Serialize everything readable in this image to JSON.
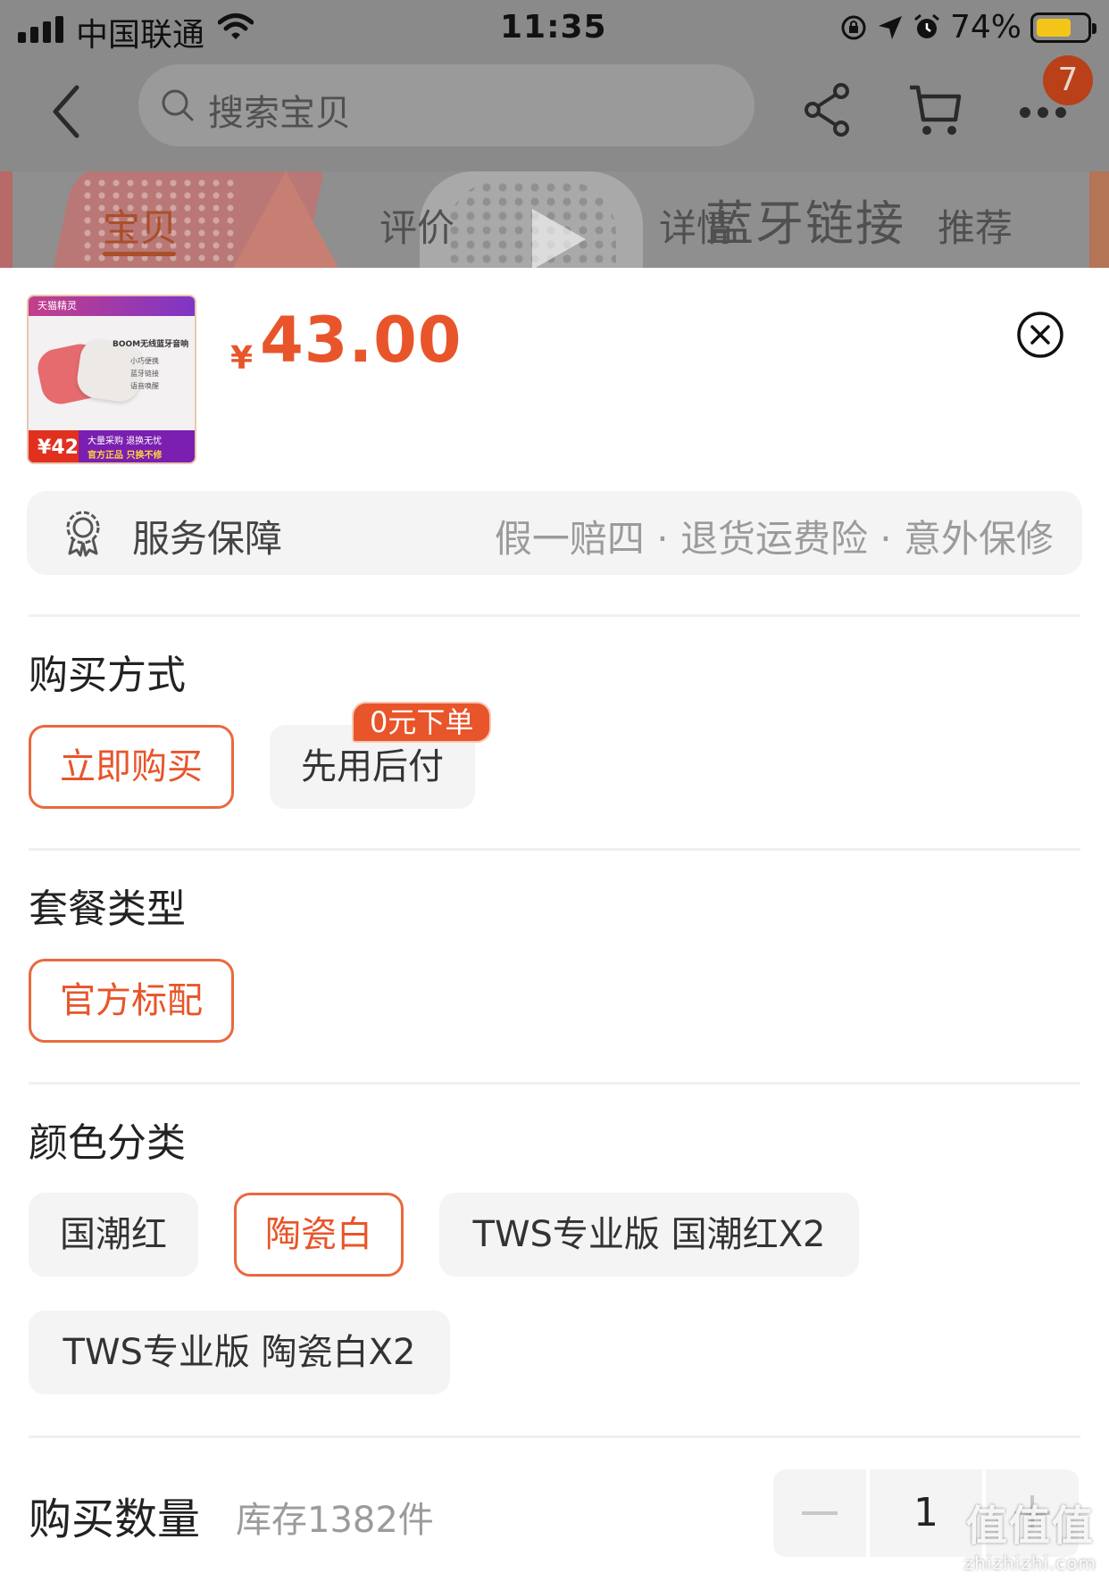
{
  "status_bar": {
    "carrier": "中国联通",
    "time": "11:35",
    "battery": "74%",
    "battery_level": 0.74
  },
  "nav": {
    "search_placeholder": "搜索宝贝",
    "cart_badge": "7"
  },
  "tabs": [
    {
      "label": "宝贝",
      "active": true
    },
    {
      "label": "评价",
      "active": false
    },
    {
      "label": "详情",
      "active": false
    },
    {
      "label": "推荐",
      "active": false
    }
  ],
  "product_overlay_headline": "蓝牙链接",
  "thumbnail": {
    "brand": "天猫精灵",
    "title": "BOOM无线蓝牙音响",
    "lines": [
      "小巧便携",
      "蓝牙链接",
      "语音唤醒"
    ],
    "price": "42",
    "tagline": "大量采购 退换无忧",
    "tagline2": "官方正品 只换不修"
  },
  "price": {
    "currency": "¥",
    "amount": "43.00"
  },
  "service": {
    "label": "服务保障",
    "values": "假一赔四 · 退货运费险 · 意外保修"
  },
  "purchase_method": {
    "title": "购买方式",
    "options": [
      {
        "label": "立即购买",
        "selected": true
      },
      {
        "label": "先用后付",
        "selected": false
      }
    ],
    "badge": "0元下单"
  },
  "package_type": {
    "title": "套餐类型",
    "options": [
      {
        "label": "官方标配",
        "selected": true
      }
    ]
  },
  "color_category": {
    "title": "颜色分类",
    "options": [
      {
        "label": "国潮红",
        "selected": false
      },
      {
        "label": "陶瓷白",
        "selected": true
      },
      {
        "label": "TWS专业版 国潮红X2",
        "selected": false
      },
      {
        "label": "TWS专业版 陶瓷白X2",
        "selected": false
      }
    ]
  },
  "quantity": {
    "label": "购买数量",
    "stock": "库存1382件",
    "value": "1"
  },
  "watermark": {
    "main": "值值值",
    "sub": "zhizhizhi.com"
  },
  "colors": {
    "accent": "#e8552a",
    "accent_border": "#e9693e",
    "option_bg": "#f4f4f4"
  }
}
